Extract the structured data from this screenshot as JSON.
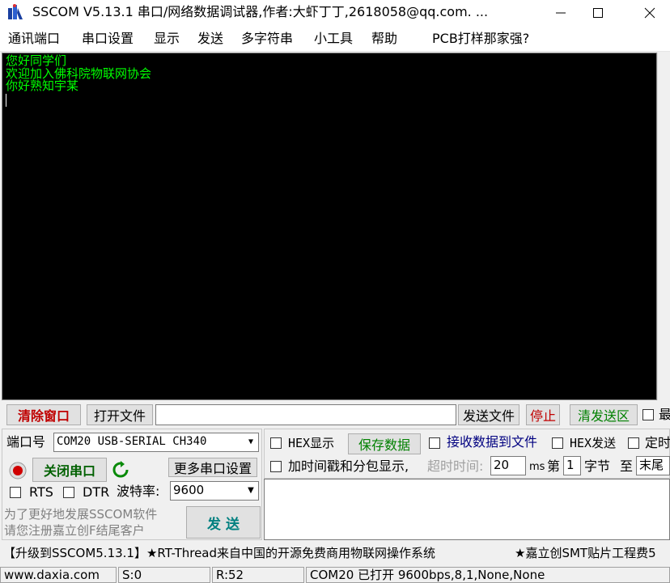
{
  "window": {
    "title": "SSCOM V5.13.1 串口/网络数据调试器,作者:大虾丁丁,2618058@qq.com. ...",
    "min_glyph": "—",
    "max_glyph": "☐",
    "close_glyph": "✕"
  },
  "menu": [
    "通讯端口",
    "串口设置",
    "显示",
    "发送",
    "多字符串",
    "小工具",
    "帮助",
    "PCB打样那家强?"
  ],
  "terminal": {
    "lines": [
      "您好同学们",
      "欢迎加入佛科院物联网协会",
      "你好熟知宇某"
    ],
    "text_color": "#00ff00",
    "bg_color": "#000000"
  },
  "toolbar": {
    "clear_window": "清除窗口",
    "open_file": "打开文件",
    "file_path": "",
    "send_file": "发送文件",
    "stop": "停止",
    "clear_send": "清发送区",
    "max_label": "最"
  },
  "port": {
    "port_label": "端口号",
    "port_value": "COM20 USB-SERIAL CH340",
    "close_port": "关闭串口",
    "more_settings": "更多串口设置",
    "rts": "RTS",
    "dtr": "DTR",
    "baud_label": "波特率:",
    "baud_value": "9600"
  },
  "options": {
    "hex_display": "HEX显示",
    "save_data": "保存数据",
    "recv_to_file": "接收数据到文件",
    "hex_send": "HEX发送",
    "timed": "定时",
    "timestamp": "加时间戳和分包显示,",
    "timeout_label": "超时时间:",
    "timeout_value": "20",
    "ms": "ms",
    "nth": "第",
    "byte_index": "1",
    "bytes": "字节",
    "to": "至",
    "tail": "末尾"
  },
  "promo": {
    "line1": "为了更好地发展SSCOM软件",
    "line2": "请您注册嘉立创F结尾客户",
    "send": "发  送"
  },
  "ticker": {
    "left": "【升级到SSCOM5.13.1】★RT-Thread来自中国的开源免费商用物联网操作系统",
    "right": "★嘉立创SMT贴片工程费5"
  },
  "status": {
    "website": "www.daxia.com",
    "sent": "S:0",
    "received": "R:52",
    "port_status": "COM20 已打开  9600bps,8,1,None,None"
  }
}
